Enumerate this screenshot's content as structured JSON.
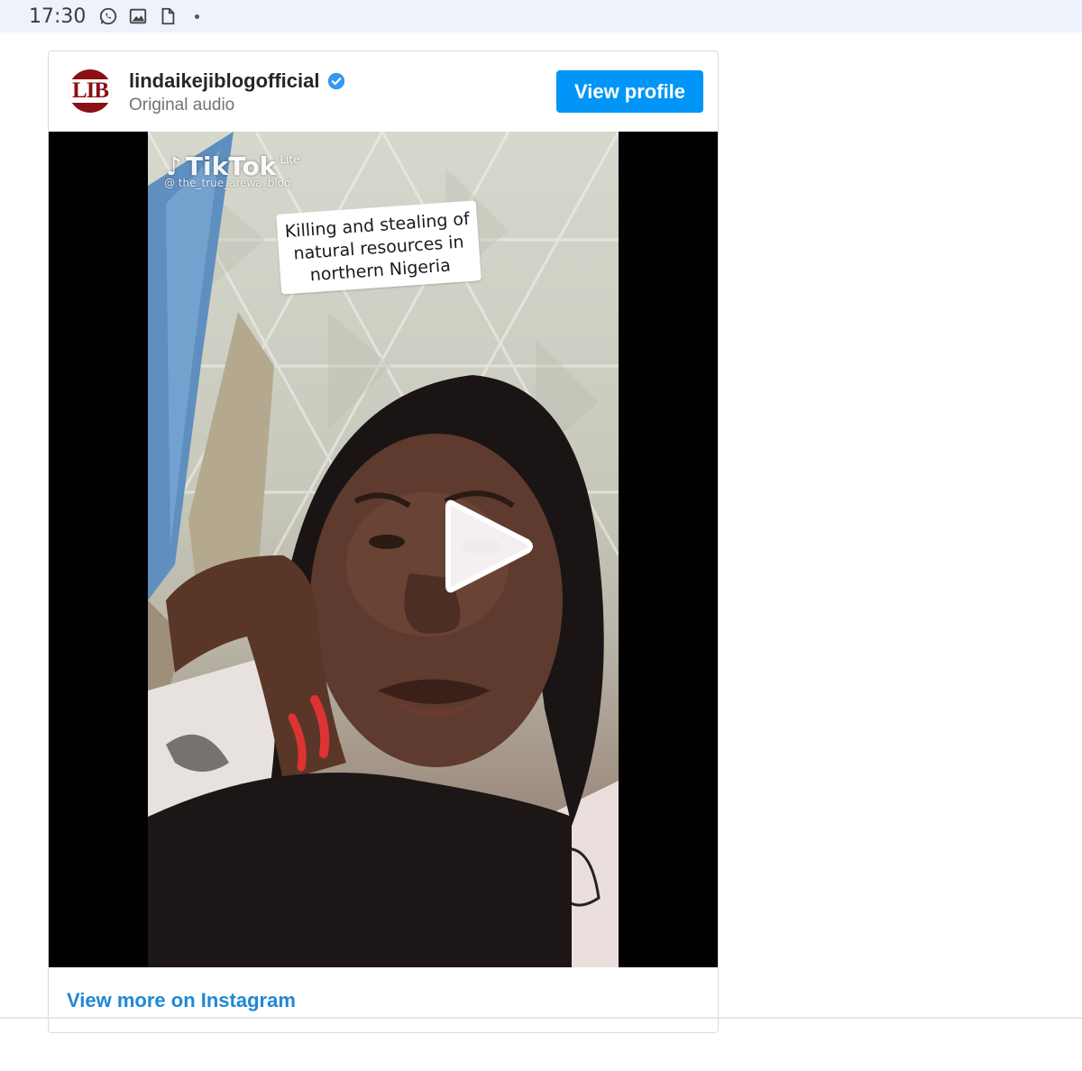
{
  "status_bar": {
    "time": "17:30",
    "icons": [
      "whatsapp-icon",
      "image-icon",
      "document-icon",
      "dot-icon"
    ]
  },
  "embed": {
    "avatar_text": "LIB",
    "username": "lindaikejiblogofficial",
    "verified": true,
    "subtitle": "Original audio",
    "view_profile_label": "View profile",
    "view_more_label": "View more on Instagram",
    "colors": {
      "button": "#0095f6",
      "link": "#1e88d6",
      "avatar": "#8b0f14"
    }
  },
  "video": {
    "watermark_brand": "TikTok",
    "watermark_suffix": "Lite",
    "watermark_handle": "@ the_true_arewa_blog",
    "caption_lines": [
      "Killing and stealing of",
      "natural resources in",
      "northern Nigeria"
    ],
    "play_icon": "play-icon"
  }
}
